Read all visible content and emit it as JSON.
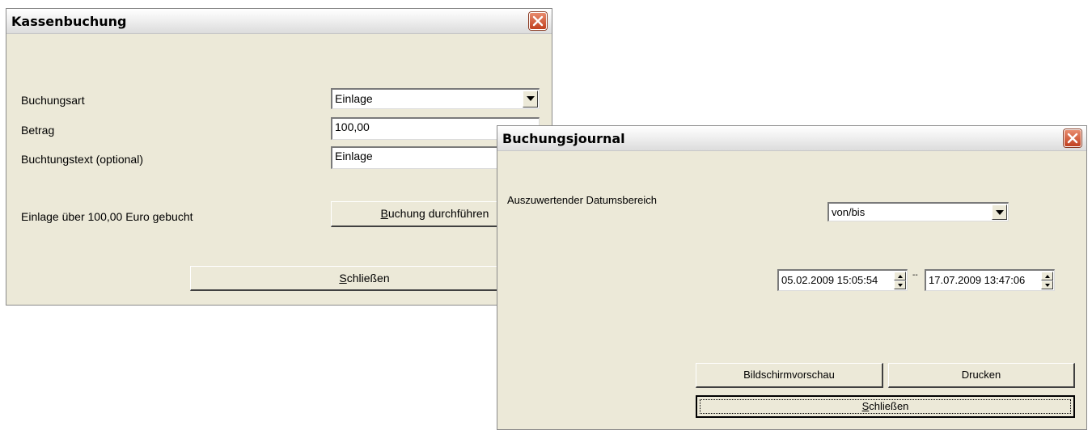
{
  "kassenbuchung": {
    "title": "Kassenbuchung",
    "buchungsart_label": "Buchungsart",
    "buchungsart_value": "Einlage",
    "betrag_label": "Betrag",
    "betrag_value": "100,00",
    "text_label": "Buchtungstext (optional)",
    "text_value": "Einlage",
    "status_text": "Einlage über 100,00 Euro gebucht",
    "buchung_button_prefix": "",
    "buchung_button_mnemonic": "B",
    "buchung_button_rest": "uchung durchführen",
    "close_button_mnemonic": "S",
    "close_button_rest": "chließen"
  },
  "buchungsjournal": {
    "title": "Buchungsjournal",
    "range_label": "Auszuwertender Datumsbereich",
    "range_mode": "von/bis",
    "date_from": "05.02.2009 15:05:54",
    "separator": "--",
    "date_to": "17.07.2009 13:47:06",
    "preview_button": "Bildschirmvorschau",
    "print_button": "Drucken",
    "close_button_mnemonic": "S",
    "close_button_rest": "chließen"
  },
  "colors": {
    "window_bg": "#ece9d8",
    "close_button": "#c1401f"
  },
  "icons": {
    "close": "close-x-icon",
    "dropdown": "chevron-down-icon",
    "spin_up": "spin-up-icon",
    "spin_down": "spin-down-icon"
  }
}
